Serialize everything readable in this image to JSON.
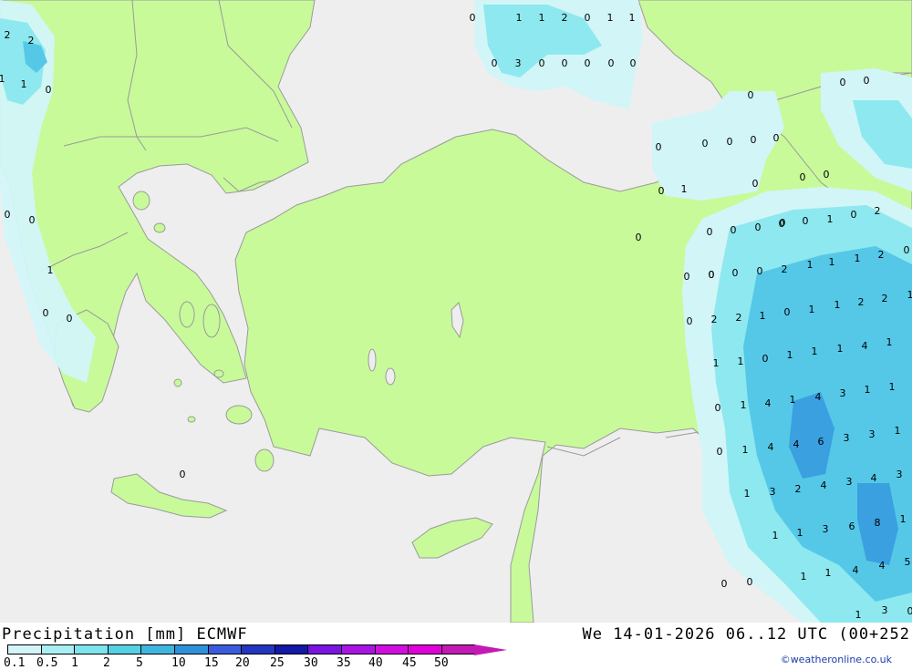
{
  "title": {
    "left": "Precipitation [mm] ECMWF",
    "right": "We 14-01-2026 06..12 UTC (00+252"
  },
  "credit": "©weatheronline.co.uk",
  "legend": {
    "labels": [
      "0.1",
      "0.5",
      "1",
      "2",
      "5",
      "10",
      "15",
      "20",
      "25",
      "30",
      "35",
      "40",
      "45",
      "50"
    ],
    "colors": [
      "#d2f5f8",
      "#a8eef2",
      "#7de3ec",
      "#55d1e4",
      "#3fb6df",
      "#2f92d8",
      "#3a5cdc",
      "#2336c2",
      "#1418a6",
      "#7a14e0",
      "#a814e4",
      "#d00ee0",
      "#e000d8",
      "#c41ab4"
    ]
  },
  "colors": {
    "land": "#c8fa9a",
    "sea": "#eeeeee",
    "border": "#9a9a9a",
    "precip_light": "#d2f5f8",
    "precip_mid": "#8ee8ef",
    "precip_heavy": "#55c8e8",
    "precip_max": "#3aa0e0"
  },
  "values": [
    "0",
    "1",
    "1",
    "2",
    "0",
    "1",
    "1",
    "0",
    "3",
    "0",
    "0",
    "0",
    "0",
    "0",
    "2",
    "2",
    "1",
    "1",
    "0",
    "0",
    "0",
    "0",
    "0",
    "0",
    "0",
    "0",
    "0",
    "0",
    "0",
    "0",
    "1",
    "0",
    "0",
    "0",
    "0",
    "0",
    "0",
    "0",
    "0",
    "0",
    "0",
    "0",
    "0",
    "1",
    "0",
    "2",
    "0",
    "0",
    "1",
    "0",
    "2",
    "1",
    "1",
    "1",
    "2",
    "0",
    "0",
    "2",
    "2",
    "1",
    "0",
    "1",
    "1",
    "2",
    "2",
    "1",
    "1",
    "1",
    "0",
    "1",
    "1",
    "1",
    "4",
    "1",
    "0",
    "1",
    "4",
    "1",
    "4",
    "3",
    "1",
    "1",
    "0",
    "1",
    "4",
    "4",
    "6",
    "3",
    "3",
    "1",
    "1",
    "3",
    "2",
    "4",
    "3",
    "4",
    "3",
    "1",
    "1",
    "3",
    "6",
    "8",
    "1",
    "1",
    "1",
    "4",
    "4",
    "5",
    "0",
    "0",
    "0",
    "0",
    "0",
    "0",
    "0",
    "1",
    "1",
    "3",
    "0",
    "0",
    "0",
    "0"
  ]
}
